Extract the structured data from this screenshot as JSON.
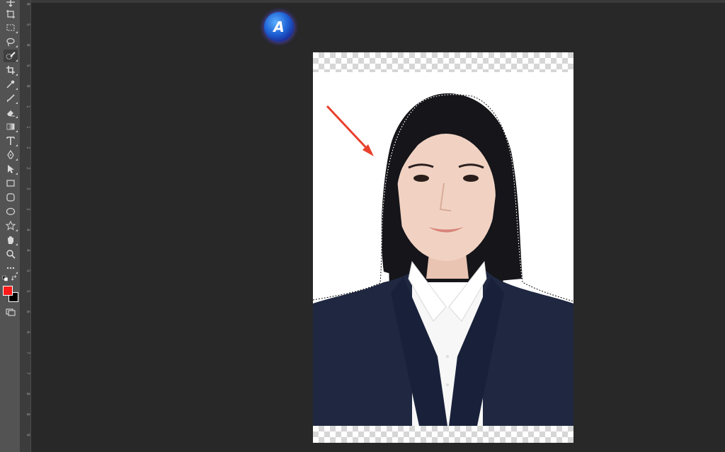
{
  "toolbar": {
    "tools": [
      {
        "name": "move-tool"
      },
      {
        "name": "artboard-tool"
      },
      {
        "name": "marquee-tool"
      },
      {
        "name": "lasso-tool"
      },
      {
        "name": "quick-selection-tool",
        "active": true
      },
      {
        "name": "crop-tool"
      },
      {
        "name": "eyedropper-tool"
      },
      {
        "name": "brush-tool"
      },
      {
        "name": "eraser-tool"
      },
      {
        "name": "gradient-tool"
      },
      {
        "name": "type-tool"
      },
      {
        "name": "pen-tool"
      },
      {
        "name": "path-selection-tool"
      },
      {
        "name": "rectangle-tool"
      },
      {
        "name": "rounded-rectangle-tool"
      },
      {
        "name": "ellipse-tool"
      },
      {
        "name": "custom-shape-tool"
      },
      {
        "name": "hand-tool"
      },
      {
        "name": "zoom-tool"
      },
      {
        "name": "more-tools"
      }
    ],
    "foreground_color": "#ff1a1a",
    "background_color": "#000000"
  },
  "ruler": {
    "ticks": [
      "0",
      "5",
      "0",
      "5",
      "0",
      "1",
      "1",
      "2",
      "2",
      "3",
      "3",
      "4",
      "4",
      "5",
      "5",
      "6",
      "6",
      "7",
      "7",
      "8",
      "8",
      "9"
    ]
  },
  "badge": {
    "letter": "A"
  },
  "document": {
    "transparency": true,
    "annotation": "red-arrow",
    "colors": {
      "hair": "#15151a",
      "skin": "#f1d2c2",
      "blazer": "#1f2840",
      "shirt": "#f7f7f7",
      "arrow": "#e8412e"
    }
  }
}
